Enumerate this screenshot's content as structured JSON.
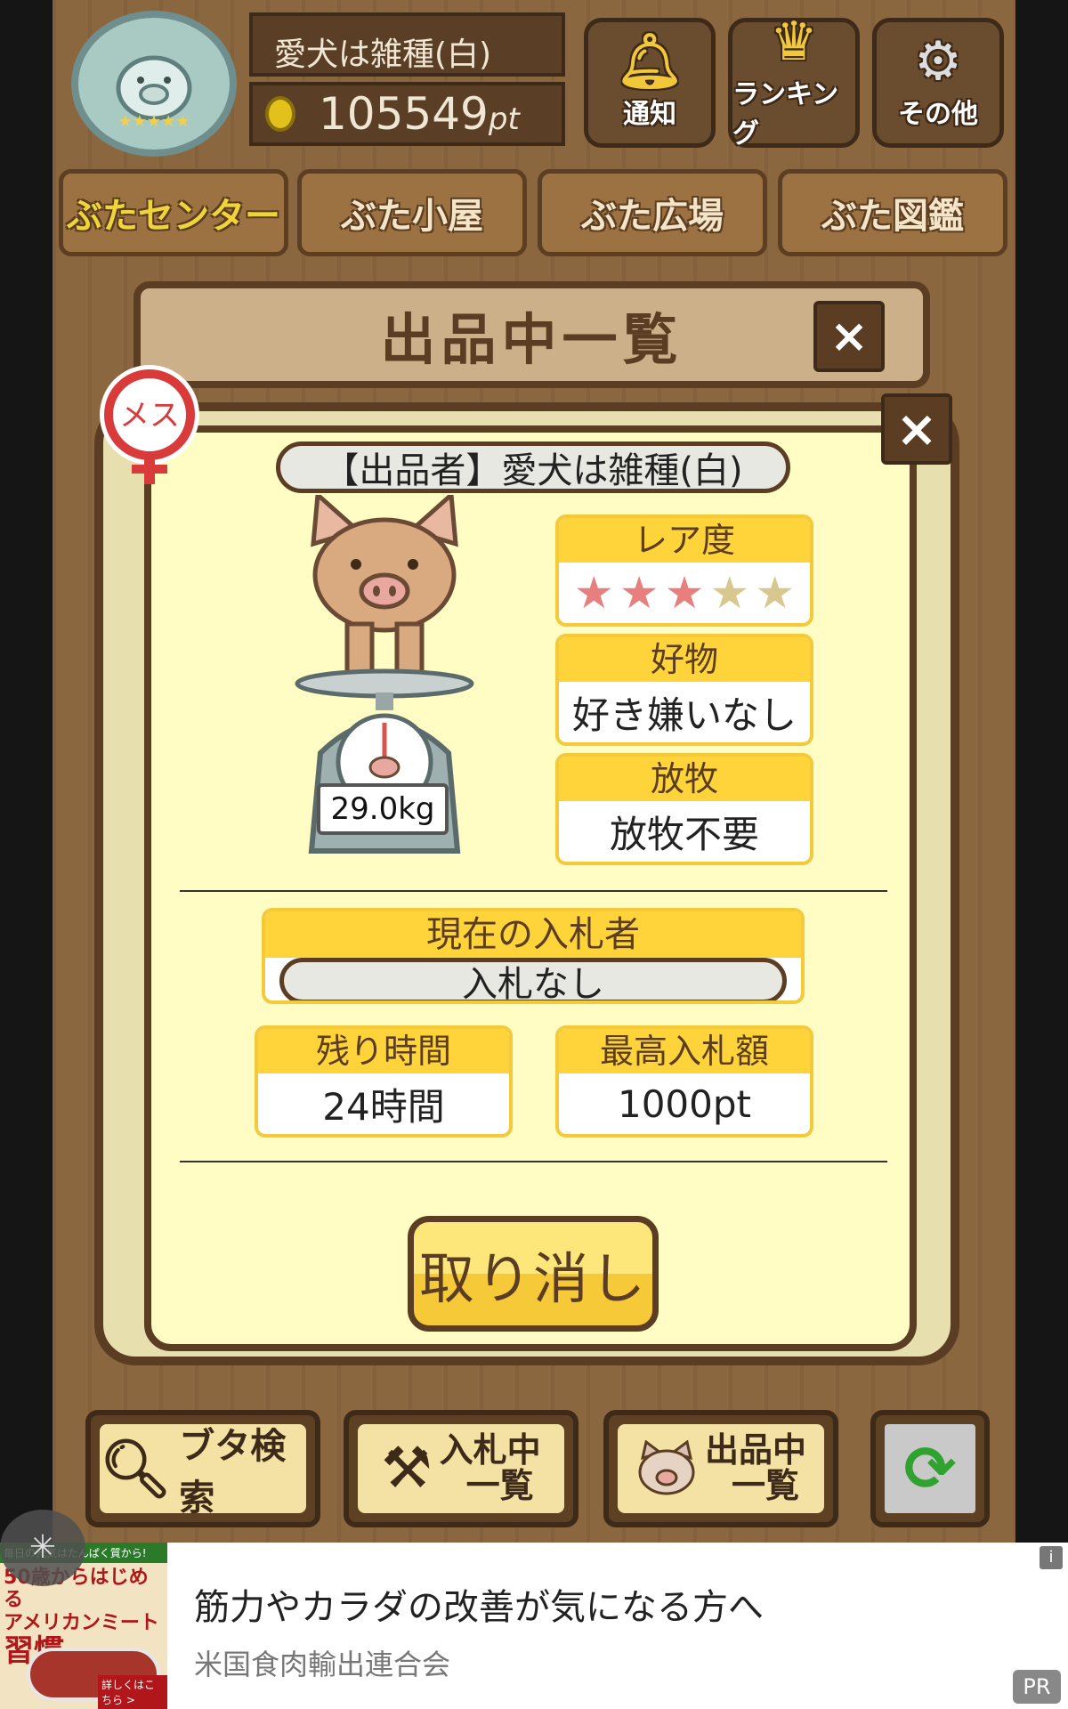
{
  "header": {
    "player_name": "愛犬は雑種(白)",
    "points": "105549",
    "points_unit": "pt",
    "buttons": [
      {
        "label": "通知",
        "icon": "bell-icon"
      },
      {
        "label": "ランキング",
        "icon": "crown-icon"
      },
      {
        "label": "その他",
        "icon": "gear-icon"
      }
    ]
  },
  "tabs": [
    {
      "label": "ぶたセンター",
      "active": true
    },
    {
      "label": "ぶた小屋",
      "active": false
    },
    {
      "label": "ぶた広場",
      "active": false
    },
    {
      "label": "ぶた図鑑",
      "active": false
    }
  ],
  "list_title": "出品中一覧",
  "close_symbol": "×",
  "detail": {
    "gender_badge": "メス",
    "seller": "【出品者】愛犬は雑種(白)",
    "weight": "29.0kg",
    "rarity": {
      "label": "レア度",
      "stars_filled": 3,
      "stars_total": 5
    },
    "favorite": {
      "label": "好物",
      "value": "好き嫌いなし"
    },
    "grazing": {
      "label": "放牧",
      "value": "放牧不要"
    },
    "current_bidder": {
      "label": "現在の入札者",
      "value": "入札なし"
    },
    "time_left": {
      "label": "残り時間",
      "value": "24時間"
    },
    "top_bid": {
      "label": "最高入札額",
      "value": "1000pt"
    },
    "cancel_label": "取り消し"
  },
  "toolbar": {
    "search_label": "ブタ検索",
    "bidding_line1": "入札中",
    "bidding_line2": "一覧",
    "listing_line1": "出品中",
    "listing_line2": "一覧"
  },
  "ad": {
    "image_topline": "毎日の元気はたんぱく質から!",
    "image_line1": "50歳からはじめる",
    "image_line2": "アメリカンミート",
    "image_line3": "習慣",
    "image_more": "詳しくはこちら >",
    "headline": "筋力やカラダの改善が気になる方へ",
    "sponsor": "米国食肉輸出連合会",
    "pr_label": "PR",
    "info_label": "i"
  },
  "colors": {
    "wood": "#8b6740",
    "dark_brown": "#5a3d22",
    "modal_bg": "#fffcc4",
    "card_header": "#fed43a",
    "star_filled": "#e87f7f",
    "star_empty": "#d8c78f"
  }
}
